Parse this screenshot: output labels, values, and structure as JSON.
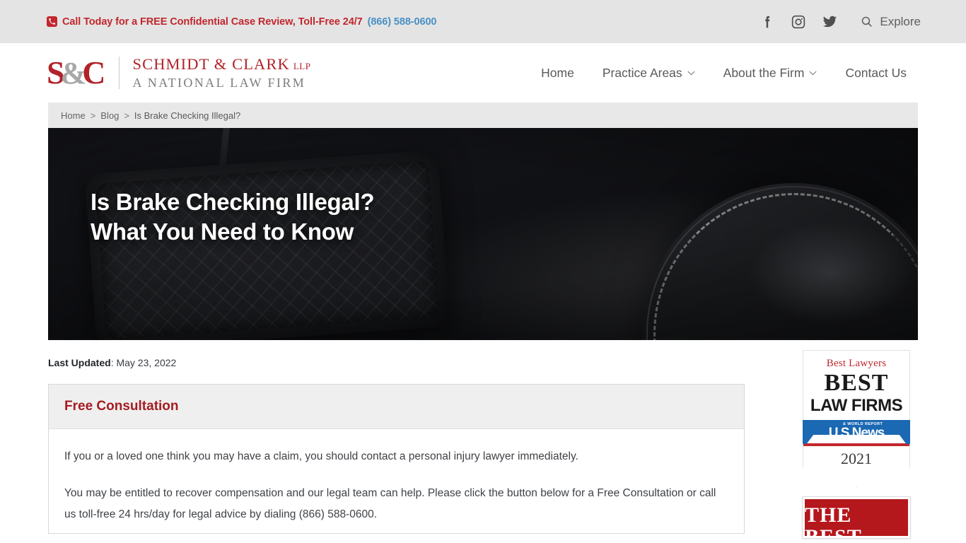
{
  "topbar": {
    "phone_icon": "phone-icon",
    "call_text": "Call Today for a FREE Confidential Case Review, Toll-Free 24/7",
    "call_phone": "(866) 588-0600",
    "social": [
      {
        "name": "facebook-icon",
        "label": "Facebook"
      },
      {
        "name": "instagram-icon",
        "label": "Instagram"
      },
      {
        "name": "twitter-icon",
        "label": "Twitter"
      }
    ],
    "search_icon": "search-icon",
    "explore_label": "Explore"
  },
  "logo": {
    "mark_s": "S",
    "mark_amp": "&",
    "mark_c": "C",
    "line1": "SCHMIDT & CLARK",
    "line1_suffix": "LLP",
    "line2": "A NATIONAL LAW FIRM"
  },
  "nav": {
    "items": [
      {
        "label": "Home",
        "caret": false
      },
      {
        "label": "Practice Areas",
        "caret": true
      },
      {
        "label": "About the Firm",
        "caret": true
      },
      {
        "label": "Contact Us",
        "caret": false
      }
    ],
    "caret_glyph": "⌄"
  },
  "breadcrumb": {
    "home": "Home",
    "sep1": ">",
    "blog": "Blog",
    "sep2": ">",
    "current": "Is Brake Checking Illegal?"
  },
  "hero": {
    "title_line1": "Is Brake Checking Illegal?",
    "title_line2": "What You Need to Know",
    "image_description": "brake-pedal-and-shoe-photo"
  },
  "article": {
    "last_updated_label": "Last Updated",
    "last_updated_value": ": May 23, 2022"
  },
  "consultation": {
    "heading": "Free Consultation",
    "paragraph1": "If you or a loved one think you may have a claim, you should contact a personal injury lawyer immediately.",
    "paragraph2": "You may be entitled to recover compensation and our legal team can help. Please click the button below for a Free Consultation or call us toll-free 24 hrs/day for legal advice by dialing (866) 588-0600."
  },
  "sidebar": {
    "badge_usnews": {
      "top_text": "Best Lawyers",
      "best": "BEST",
      "law_firms": "LAW FIRMS",
      "ribbon_sub": "& WORLD REPORT",
      "ribbon_main": "U.S.News",
      "year": "2021"
    },
    "badge_thebest": {
      "line1": "THE BEST"
    }
  },
  "colors": {
    "brand_red": "#b1232a",
    "accent_red": "#c1272d",
    "heading_red": "#a51c22",
    "phone_blue": "#4a90c4",
    "topbar_bg": "#e4e4e4",
    "crumb_bg": "#e8e8e8",
    "box_head_bg": "#efefef",
    "usnews_blue": "#1b68b3"
  }
}
